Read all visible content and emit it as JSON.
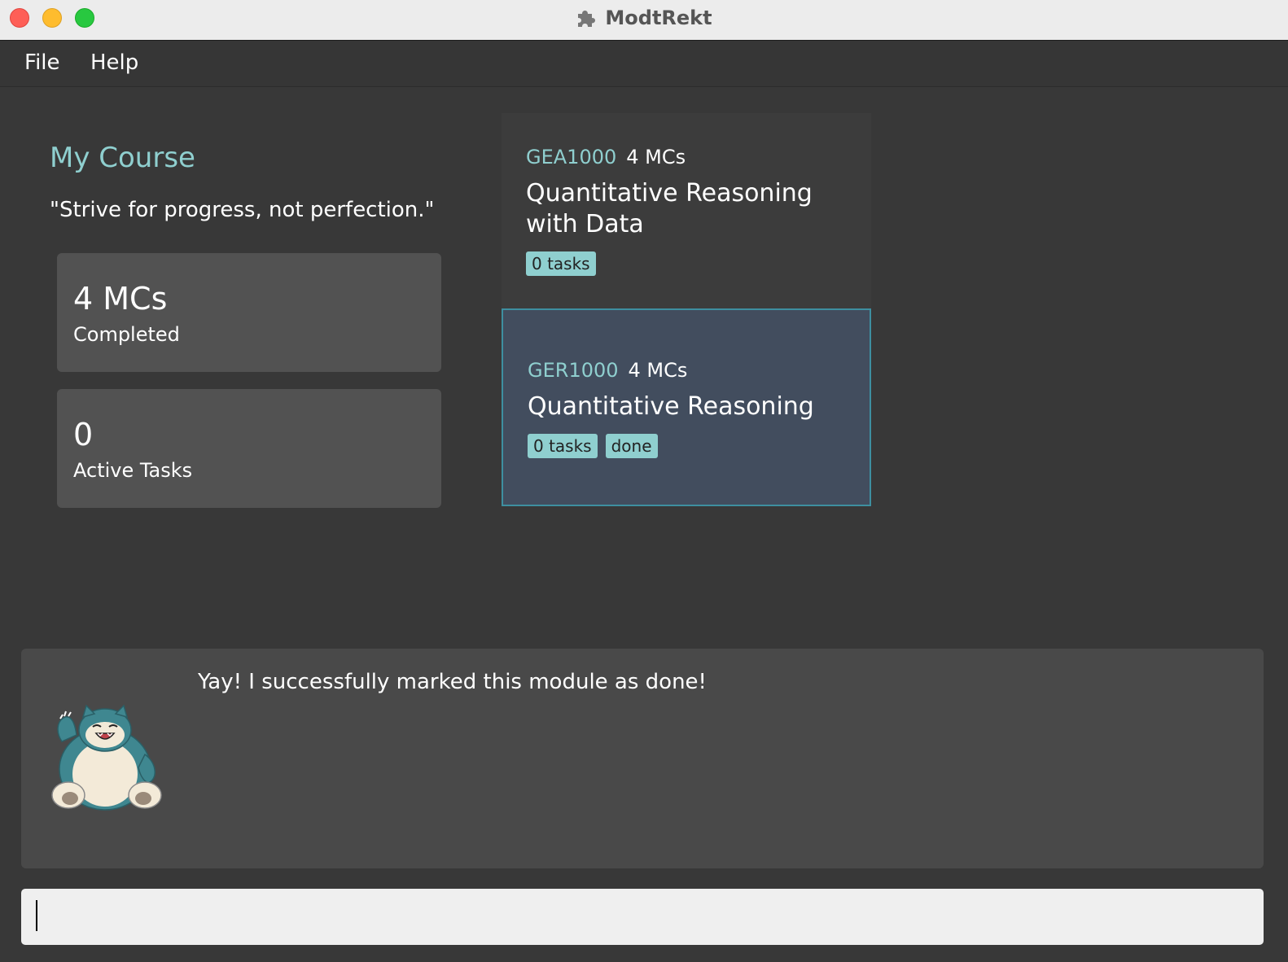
{
  "window": {
    "title": "ModtRekt"
  },
  "menu": {
    "file": "File",
    "help": "Help"
  },
  "summary": {
    "title": "My Course",
    "quote": "\"Strive for progress, not perfection.\"",
    "stats": [
      {
        "value": "4 MCs",
        "label": "Completed"
      },
      {
        "value": "0",
        "label": "Active Tasks"
      }
    ]
  },
  "modules": [
    {
      "code": "GEA1000",
      "mcs": "4 MCs",
      "name": "Quantitative Reasoning with Data",
      "tags": [
        "0 tasks"
      ],
      "selected": false
    },
    {
      "code": "GER1000",
      "mcs": "4 MCs",
      "name": "Quantitative Reasoning",
      "tags": [
        "0 tasks",
        "done"
      ],
      "selected": true
    }
  ],
  "result": {
    "message": "Yay! I successfully marked this module as done!"
  },
  "command": {
    "value": ""
  },
  "colors": {
    "accent": "#8fcfcf",
    "selected_border": "#3e8fa0",
    "selected_bg": "#424d5e"
  }
}
